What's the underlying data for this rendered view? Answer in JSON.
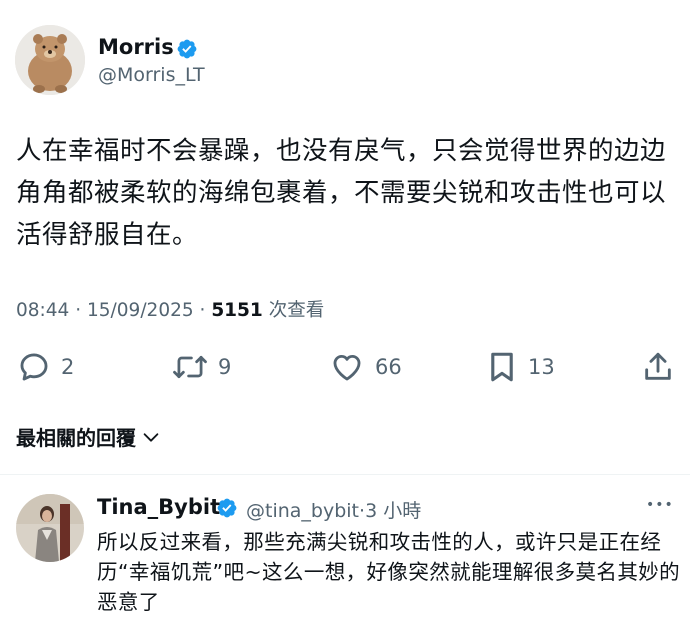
{
  "tweet": {
    "author_name": "Morris",
    "author_handle": "@Morris_LT",
    "text": "人在幸福时不会暴躁，也没有戾气，只会觉得世界的边边角角都被柔软的海绵包裹着，不需要尖锐和攻击性也可以活得舒服自在。",
    "time": "08:44",
    "date": "15/09/2025",
    "views_count": "5151",
    "views_label": "次查看",
    "separator": "·"
  },
  "actions": {
    "reply_count": "2",
    "retweet_count": "9",
    "like_count": "66",
    "bookmark_count": "13"
  },
  "replies_sort": {
    "label": "最相關的回覆"
  },
  "reply": {
    "author_name": "Tina_Bybit",
    "author_handle": "@tina_bybit",
    "separator": "·",
    "time": "3 小時",
    "more": "•••",
    "text": "所以反过来看，那些充满尖锐和攻击性的人，或许只是正在经历“幸福饥荒”吧~这么一想，好像突然就能理解很多莫名其妙的恶意了"
  },
  "colors": {
    "verified": "#1d9bf0",
    "secondary_text": "#536471",
    "primary_text": "#0f1419"
  }
}
